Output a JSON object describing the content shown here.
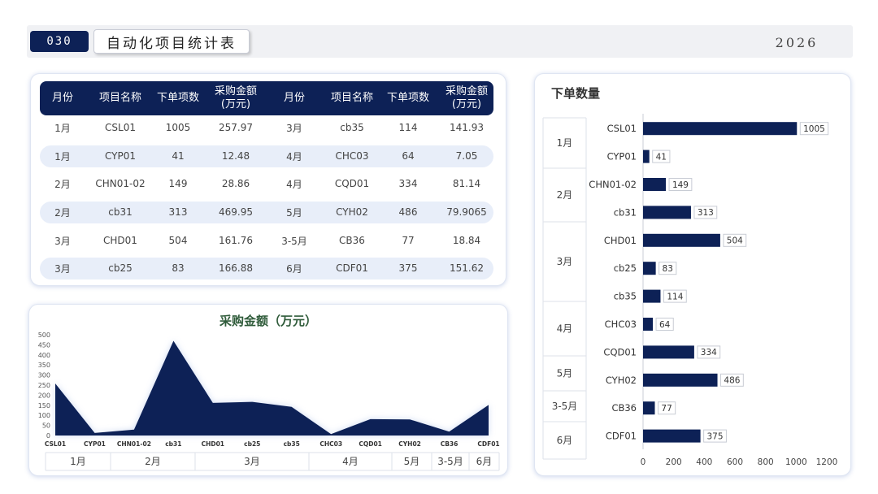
{
  "header": {
    "page_number": "030",
    "title": "自动化项目统计表",
    "year": "2026"
  },
  "table": {
    "headers": [
      "月份",
      "项目名称",
      "下单项数",
      "采购金额\n(万元)",
      "月份",
      "项目名称",
      "下单项数",
      "采购金额\n(万元)"
    ],
    "rows": [
      [
        "1月",
        "CSL01",
        "1005",
        "257.97",
        "3月",
        "cb35",
        "114",
        "141.93"
      ],
      [
        "1月",
        "CYP01",
        "41",
        "12.48",
        "4月",
        "CHC03",
        "64",
        "7.05"
      ],
      [
        "2月",
        "CHN01-02",
        "149",
        "28.86",
        "4月",
        "CQD01",
        "334",
        "81.14"
      ],
      [
        "2月",
        "cb31",
        "313",
        "469.95",
        "5月",
        "CYH02",
        "486",
        "79.9065"
      ],
      [
        "3月",
        "CHD01",
        "504",
        "161.76",
        "3-5月",
        "CB36",
        "77",
        "18.84"
      ],
      [
        "3月",
        "cb25",
        "83",
        "166.88",
        "6月",
        "CDF01",
        "375",
        "151.62"
      ]
    ]
  },
  "chart_data": [
    {
      "type": "area",
      "title": "采购金额（万元）",
      "categories": [
        "CSL01",
        "CYP01",
        "CHN01-02",
        "cb31",
        "CHD01",
        "cb25",
        "cb35",
        "CHC03",
        "CQD01",
        "CYH02",
        "CB36",
        "CDF01"
      ],
      "values": [
        257.97,
        12.48,
        28.86,
        469.95,
        161.76,
        166.88,
        141.93,
        7.05,
        81.14,
        79.9065,
        18.84,
        151.62
      ],
      "ylim": [
        0,
        500
      ],
      "yticks": [
        0,
        50,
        100,
        150,
        200,
        250,
        300,
        350,
        400,
        450,
        500
      ],
      "groups": [
        {
          "label": "1月",
          "count": 2
        },
        {
          "label": "2月",
          "count": 2
        },
        {
          "label": "3月",
          "count": 3
        },
        {
          "label": "4月",
          "count": 2
        },
        {
          "label": "5月",
          "count": 1
        },
        {
          "label": "3-5月",
          "count": 1
        },
        {
          "label": "6月",
          "count": 1
        }
      ],
      "color": "#0d2156"
    },
    {
      "type": "bar",
      "orientation": "horizontal",
      "title": "下单数量",
      "categories": [
        "CSL01",
        "CYP01",
        "CHN01-02",
        "cb31",
        "CHD01",
        "cb25",
        "cb35",
        "CHC03",
        "CQD01",
        "CYH02",
        "CB36",
        "CDF01"
      ],
      "values": [
        1005,
        41,
        149,
        313,
        504,
        83,
        114,
        64,
        334,
        486,
        77,
        375
      ],
      "xlim": [
        0,
        1200
      ],
      "xticks": [
        0,
        200,
        400,
        600,
        800,
        1000,
        1200
      ],
      "groups": [
        {
          "label": "1月",
          "count": 2
        },
        {
          "label": "2月",
          "count": 2
        },
        {
          "label": "3月",
          "count": 3
        },
        {
          "label": "4月",
          "count": 2
        },
        {
          "label": "5月",
          "count": 1
        },
        {
          "label": "3-5月",
          "count": 1
        },
        {
          "label": "6月",
          "count": 1
        }
      ],
      "color": "#0d2156"
    }
  ]
}
